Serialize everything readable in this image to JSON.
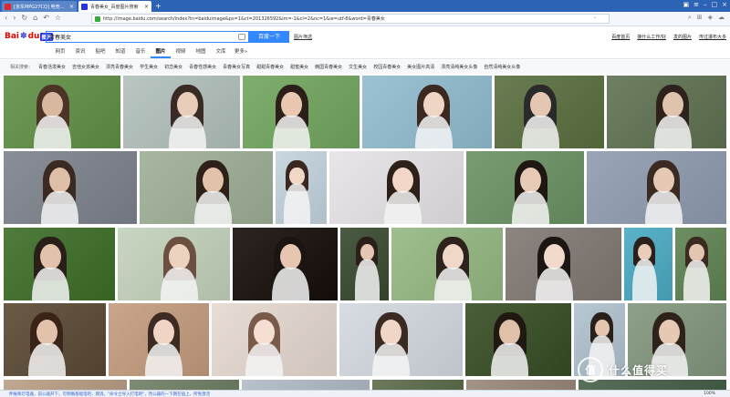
{
  "browser": {
    "tabs": [
      {
        "title": "[京东MPG27CQ] 电竞...",
        "active": false
      },
      {
        "title": "青春美女_百度图片搜索",
        "active": true
      }
    ],
    "new_tab": "+",
    "url": "http://image.baidu.com/search/index?tn=baiduimage&ps=1&ct=201326592&lm=-1&cl=2&nc=1&ie=utf-8&word=青春美女"
  },
  "header": {
    "logo_bai": "Bai",
    "logo_paw": "&",
    "logo_du": "du",
    "logo_tu": "图片",
    "search_value": "青春美女",
    "search_button": "百度一下",
    "advanced": "图片筛选",
    "top_links": [
      "百度首页",
      "接什么工作/好",
      "发的图片",
      "传过瀑布大多"
    ]
  },
  "tabs": [
    "网页",
    "资讯",
    "贴吧",
    "知道",
    "音乐",
    "图片",
    "视频",
    "地图",
    "文库",
    "更多»"
  ],
  "active_tab": "图片",
  "related": {
    "label": "相关搜索：",
    "items": [
      "青春活泼美女",
      "吉他女孩美女",
      "漂亮青春美女",
      "学生美女",
      "初恋美女",
      "青春性感美女",
      "青春美女写真",
      "甜甜青春美女",
      "甜蜜美女",
      "韩国青春美女",
      "文生美女",
      "校园青春美女",
      "美女图片高清",
      "漂亮清纯美女头像",
      "自然清纯美女头像"
    ]
  },
  "status": {
    "text": "伸展和灯电器，前公器开下，可明确基础电吧，期消。\"命令立导入打电吧\"，然公器的一下期在插上，所免激活",
    "zoom": "100%"
  },
  "watermark": {
    "badge": "值",
    "text": "什么值得买"
  }
}
